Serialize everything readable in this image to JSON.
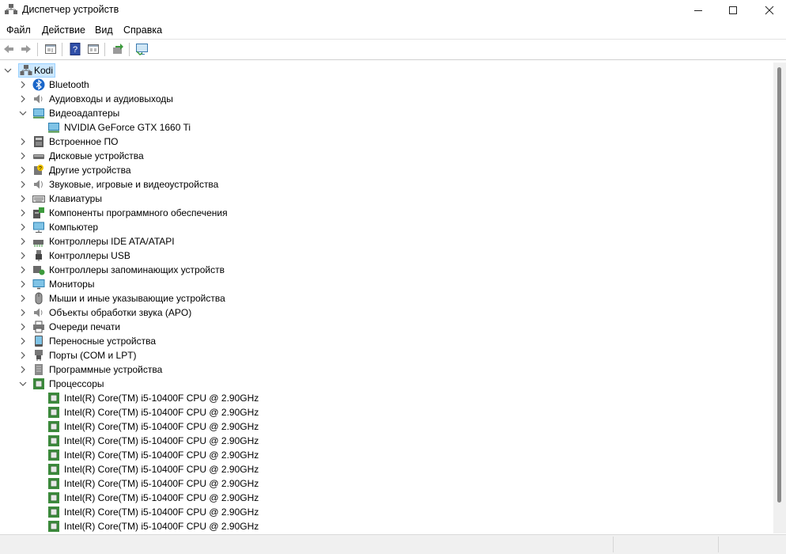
{
  "window": {
    "title": "Диспетчер устройств"
  },
  "menu": [
    "Файл",
    "Действие",
    "Вид",
    "Справка"
  ],
  "toolbar": [
    "back-icon",
    "forward-icon",
    "properties-icon",
    "help-icon",
    "view-icon",
    "update-driver-icon",
    "scan-hardware-icon"
  ],
  "tree": {
    "root": "Kodi",
    "categories": [
      {
        "label": "Bluetooth",
        "icon": "bluetooth-icon",
        "expanded": false
      },
      {
        "label": "Аудиовходы и аудиовыходы",
        "icon": "speaker-icon",
        "expanded": false
      },
      {
        "label": "Видеоадаптеры",
        "icon": "display-adapter-icon",
        "expanded": true,
        "children": [
          "NVIDIA GeForce GTX 1660 Ti"
        ]
      },
      {
        "label": "Встроенное ПО",
        "icon": "firmware-icon",
        "expanded": false
      },
      {
        "label": "Дисковые устройства",
        "icon": "disk-drive-icon",
        "expanded": false
      },
      {
        "label": "Другие устройства",
        "icon": "unknown-device-icon",
        "expanded": false
      },
      {
        "label": "Звуковые, игровые и видеоустройства",
        "icon": "sound-icon",
        "expanded": false
      },
      {
        "label": "Клавиатуры",
        "icon": "keyboard-icon",
        "expanded": false
      },
      {
        "label": "Компоненты программного обеспечения",
        "icon": "software-component-icon",
        "expanded": false
      },
      {
        "label": "Компьютер",
        "icon": "computer-icon",
        "expanded": false
      },
      {
        "label": "Контроллеры IDE ATA/ATAPI",
        "icon": "ide-controller-icon",
        "expanded": false
      },
      {
        "label": "Контроллеры USB",
        "icon": "usb-icon",
        "expanded": false
      },
      {
        "label": "Контроллеры запоминающих устройств",
        "icon": "storage-controller-icon",
        "expanded": false
      },
      {
        "label": "Мониторы",
        "icon": "monitor-icon",
        "expanded": false
      },
      {
        "label": "Мыши и иные указывающие устройства",
        "icon": "mouse-icon",
        "expanded": false
      },
      {
        "label": "Объекты обработки звука (APO)",
        "icon": "apo-icon",
        "expanded": false
      },
      {
        "label": "Очереди печати",
        "icon": "printer-icon",
        "expanded": false
      },
      {
        "label": "Переносные устройства",
        "icon": "portable-device-icon",
        "expanded": false
      },
      {
        "label": "Порты (COM и LPT)",
        "icon": "port-icon",
        "expanded": false
      },
      {
        "label": "Программные устройства",
        "icon": "software-device-icon",
        "expanded": false
      },
      {
        "label": "Процессоры",
        "icon": "processor-icon",
        "expanded": true,
        "children": [
          "Intel(R) Core(TM) i5-10400F CPU @ 2.90GHz",
          "Intel(R) Core(TM) i5-10400F CPU @ 2.90GHz",
          "Intel(R) Core(TM) i5-10400F CPU @ 2.90GHz",
          "Intel(R) Core(TM) i5-10400F CPU @ 2.90GHz",
          "Intel(R) Core(TM) i5-10400F CPU @ 2.90GHz",
          "Intel(R) Core(TM) i5-10400F CPU @ 2.90GHz",
          "Intel(R) Core(TM) i5-10400F CPU @ 2.90GHz",
          "Intel(R) Core(TM) i5-10400F CPU @ 2.90GHz",
          "Intel(R) Core(TM) i5-10400F CPU @ 2.90GHz",
          "Intel(R) Core(TM) i5-10400F CPU @ 2.90GHz"
        ]
      }
    ]
  },
  "colors": {
    "selection": "#cce8ff",
    "selection_border": "#99d1ff",
    "processor_green": "#3d8b3d"
  }
}
